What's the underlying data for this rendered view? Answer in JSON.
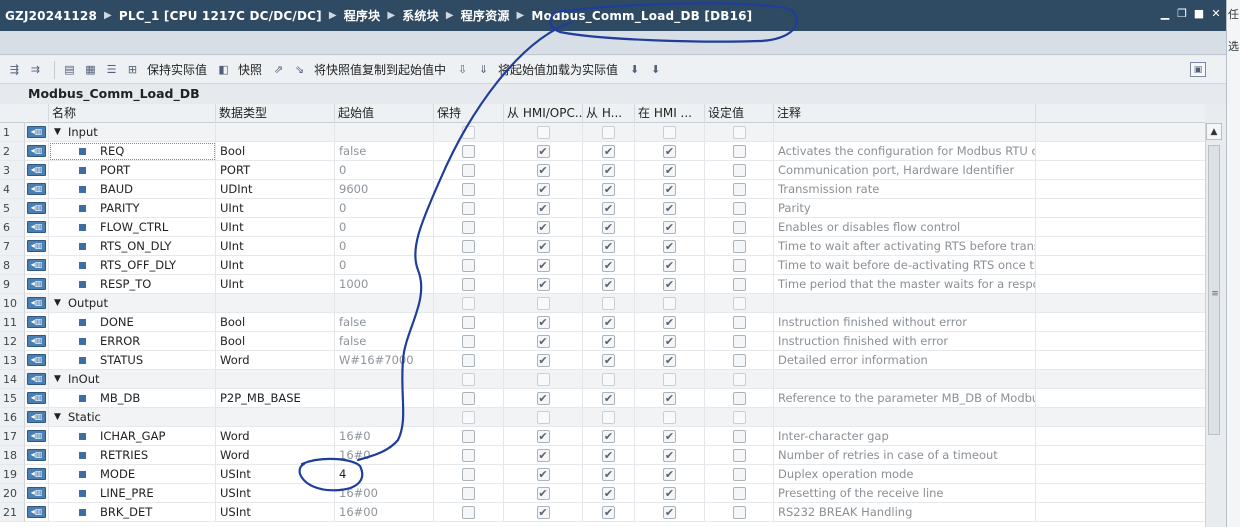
{
  "breadcrumb": [
    "GZJ20241128",
    "PLC_1 [CPU 1217C DC/DC/DC]",
    "程序块",
    "系统块",
    "程序资源",
    "Modbus_Comm_Load_DB [DB16]"
  ],
  "window_controls": [
    "minimize-icon",
    "restore-icon",
    "maximize-icon",
    "close-icon"
  ],
  "right_panel_glyphs": [
    "任",
    "选"
  ],
  "toolbar": {
    "keep_actual_label": "保持实际值",
    "snapshot_label": "快照",
    "copy_snapshot_label": "将快照值复制到起始值中",
    "load_start_label": "将起始值加载为实际值"
  },
  "db_title": "Modbus_Comm_Load_DB",
  "columns": {
    "name": "名称",
    "type": "数据类型",
    "start": "起始值",
    "retain": "保持",
    "hmi1": "从 HMI/OPC...",
    "hmi2": "从 H...",
    "hmi3": "在 HMI ...",
    "setpoint": "设定值",
    "comment": "注释"
  },
  "rows": [
    {
      "num": "1",
      "name": "Input",
      "type": "",
      "start": "",
      "comment": "",
      "section": true,
      "retain": false,
      "hmi1": false,
      "hmi2": false,
      "hmi3": false,
      "setpoint": false
    },
    {
      "num": "2",
      "name": "REQ",
      "type": "Bool",
      "start": "false",
      "comment": "Activates the configuration for Modbus RTU com",
      "section": false,
      "retain": false,
      "hmi1": true,
      "hmi2": true,
      "hmi3": true,
      "setpoint": false
    },
    {
      "num": "3",
      "name": "PORT",
      "type": "PORT",
      "start": "0",
      "comment": "Communication port, Hardware Identifier",
      "section": false,
      "retain": false,
      "hmi1": true,
      "hmi2": true,
      "hmi3": true,
      "setpoint": false
    },
    {
      "num": "4",
      "name": "BAUD",
      "type": "UDInt",
      "start": "9600",
      "comment": "Transmission rate",
      "section": false,
      "retain": false,
      "hmi1": true,
      "hmi2": true,
      "hmi3": true,
      "setpoint": false
    },
    {
      "num": "5",
      "name": "PARITY",
      "type": "UInt",
      "start": "0",
      "comment": "Parity",
      "section": false,
      "retain": false,
      "hmi1": true,
      "hmi2": true,
      "hmi3": true,
      "setpoint": false
    },
    {
      "num": "6",
      "name": "FLOW_CTRL",
      "type": "UInt",
      "start": "0",
      "comment": "Enables or disables flow control",
      "section": false,
      "retain": false,
      "hmi1": true,
      "hmi2": true,
      "hmi3": true,
      "setpoint": false
    },
    {
      "num": "7",
      "name": "RTS_ON_DLY",
      "type": "UInt",
      "start": "0",
      "comment": "Time to wait after activating RTS before transmi",
      "section": false,
      "retain": false,
      "hmi1": true,
      "hmi2": true,
      "hmi3": true,
      "setpoint": false
    },
    {
      "num": "8",
      "name": "RTS_OFF_DLY",
      "type": "UInt",
      "start": "0",
      "comment": "Time to wait before de-activating RTS once tran",
      "section": false,
      "retain": false,
      "hmi1": true,
      "hmi2": true,
      "hmi3": true,
      "setpoint": false
    },
    {
      "num": "9",
      "name": "RESP_TO",
      "type": "UInt",
      "start": "1000",
      "comment": "Time period that the master waits for a respons",
      "section": false,
      "retain": false,
      "hmi1": true,
      "hmi2": true,
      "hmi3": true,
      "setpoint": false
    },
    {
      "num": "10",
      "name": "Output",
      "type": "",
      "start": "",
      "comment": "",
      "section": true,
      "retain": false,
      "hmi1": false,
      "hmi2": false,
      "hmi3": false,
      "setpoint": false
    },
    {
      "num": "11",
      "name": "DONE",
      "type": "Bool",
      "start": "false",
      "comment": "Instruction finished without error",
      "section": false,
      "retain": false,
      "hmi1": true,
      "hmi2": true,
      "hmi3": true,
      "setpoint": false
    },
    {
      "num": "12",
      "name": "ERROR",
      "type": "Bool",
      "start": "false",
      "comment": "Instruction finished with error",
      "section": false,
      "retain": false,
      "hmi1": true,
      "hmi2": true,
      "hmi3": true,
      "setpoint": false
    },
    {
      "num": "13",
      "name": "STATUS",
      "type": "Word",
      "start": "W#16#7000",
      "comment": "Detailed error information",
      "section": false,
      "retain": false,
      "hmi1": true,
      "hmi2": true,
      "hmi3": true,
      "setpoint": false
    },
    {
      "num": "14",
      "name": "InOut",
      "type": "",
      "start": "",
      "comment": "",
      "section": true,
      "retain": false,
      "hmi1": false,
      "hmi2": false,
      "hmi3": false,
      "setpoint": false
    },
    {
      "num": "15",
      "name": "MB_DB",
      "type": "P2P_MB_BASE",
      "start": "",
      "comment": "Reference to the parameter MB_DB of Modbus_",
      "section": false,
      "retain": false,
      "hmi1": true,
      "hmi2": true,
      "hmi3": true,
      "setpoint": false
    },
    {
      "num": "16",
      "name": "Static",
      "type": "",
      "start": "",
      "comment": "",
      "section": true,
      "retain": false,
      "hmi1": false,
      "hmi2": false,
      "hmi3": false,
      "setpoint": false
    },
    {
      "num": "17",
      "name": "ICHAR_GAP",
      "type": "Word",
      "start": "16#0",
      "comment": "Inter-character gap",
      "section": false,
      "retain": false,
      "hmi1": true,
      "hmi2": true,
      "hmi3": true,
      "setpoint": false
    },
    {
      "num": "18",
      "name": "RETRIES",
      "type": "Word",
      "start": "16#0",
      "comment": "Number of retries in case of a timeout",
      "section": false,
      "retain": false,
      "hmi1": true,
      "hmi2": true,
      "hmi3": true,
      "setpoint": false
    },
    {
      "num": "19",
      "name": "MODE",
      "type": "USInt",
      "start": "4",
      "comment": "Duplex operation mode",
      "section": false,
      "retain": false,
      "hmi1": true,
      "hmi2": true,
      "hmi3": true,
      "setpoint": false
    },
    {
      "num": "20",
      "name": "LINE_PRE",
      "type": "USInt",
      "start": "16#00",
      "comment": "Presetting of the receive line",
      "section": false,
      "retain": false,
      "hmi1": true,
      "hmi2": true,
      "hmi3": true,
      "setpoint": false
    },
    {
      "num": "21",
      "name": "BRK_DET",
      "type": "USInt",
      "start": "16#00",
      "comment": "RS232 BREAK Handling",
      "section": false,
      "retain": false,
      "hmi1": true,
      "hmi2": true,
      "hmi3": true,
      "setpoint": false
    }
  ],
  "colors": {
    "titlebar": "#2f4a63",
    "annotation_ink": "#1f3d9a"
  }
}
